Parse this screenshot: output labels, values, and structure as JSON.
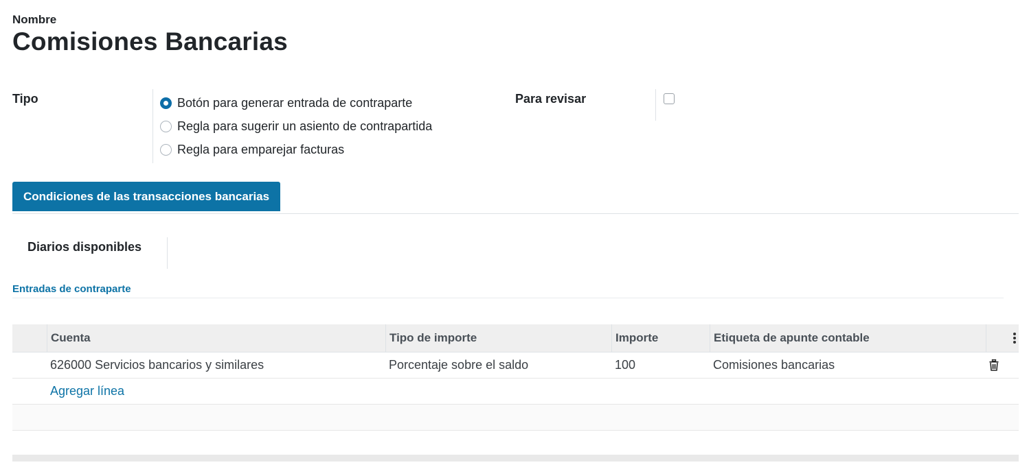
{
  "header": {
    "name_label": "Nombre",
    "record_title": "Comisiones Bancarias"
  },
  "tipo": {
    "label": "Tipo",
    "options": [
      {
        "label": "Botón para generar entrada de contraparte",
        "checked": true
      },
      {
        "label": "Regla para sugerir un asiento de contrapartida",
        "checked": false
      },
      {
        "label": "Regla para emparejar facturas",
        "checked": false
      }
    ]
  },
  "para_revisar": {
    "label": "Para revisar",
    "checked": false
  },
  "tabs": [
    {
      "label": "Condiciones de las transacciones bancarias",
      "active": true
    }
  ],
  "diarios": {
    "label": "Diarios disponibles"
  },
  "section": {
    "title": "Entradas de contraparte"
  },
  "table": {
    "columns": [
      "Cuenta",
      "Tipo de importe",
      "Importe",
      "Etiqueta de apunte contable"
    ],
    "rows": [
      {
        "cuenta": "626000 Servicios bancarios y similares",
        "tipo_importe": "Porcentaje sobre el saldo",
        "importe": "100",
        "etiqueta": "Comisiones bancarias"
      }
    ],
    "add_line": "Agregar línea"
  },
  "colors": {
    "accent": "#0d73a6",
    "text": "#212529",
    "header_bg": "#efefef"
  }
}
